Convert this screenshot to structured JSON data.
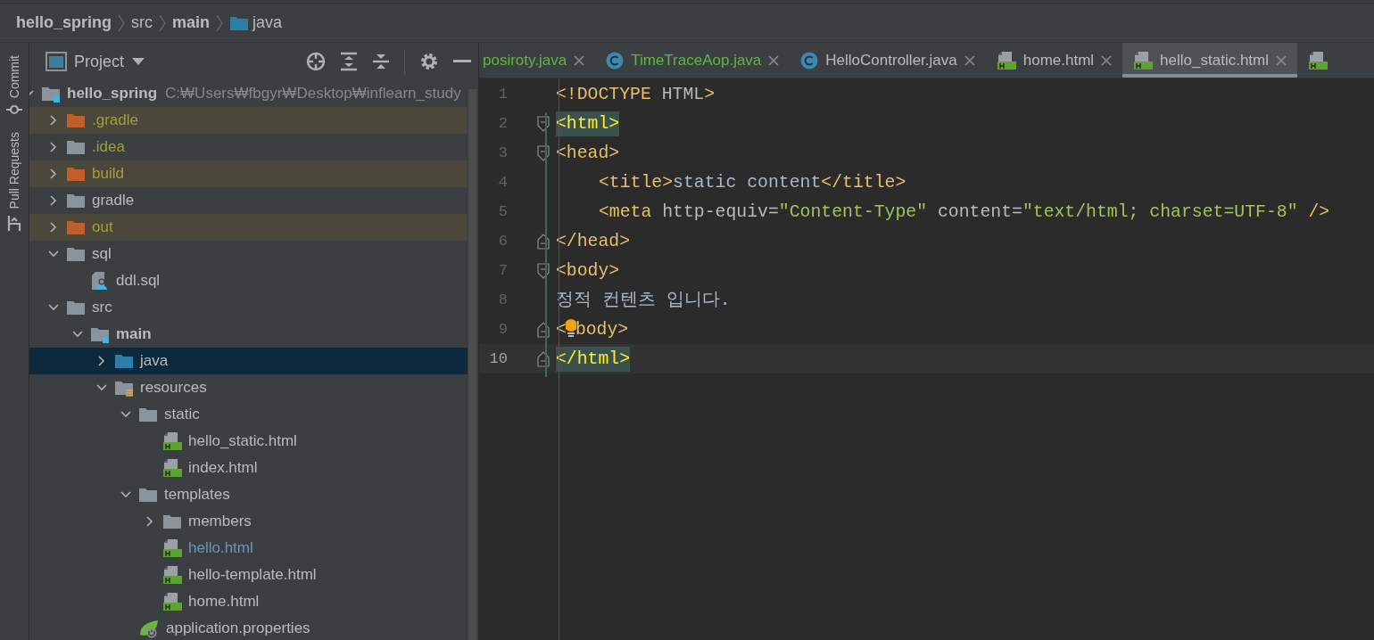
{
  "breadcrumb": [
    {
      "label": "hello_spring",
      "bold": true,
      "folder": false
    },
    {
      "label": "src",
      "bold": false,
      "folder": false
    },
    {
      "label": "main",
      "bold": true,
      "folder": false
    },
    {
      "label": "java",
      "bold": false,
      "folder": true
    }
  ],
  "side_tabs": [
    "Commit",
    "Pull Requests"
  ],
  "project_panel": {
    "view": "Project",
    "root": {
      "name": "hello_spring",
      "path": "C:₩Users₩fbgyr₩Desktop₩inflearn_study",
      "expanded": true
    },
    "tree": [
      {
        "name": ".gradle",
        "kind": "folder",
        "excluded": true,
        "ignored": true,
        "modified": false,
        "expanded": false,
        "selected": false
      },
      {
        "name": ".idea",
        "kind": "folder",
        "excluded": false,
        "ignored": true,
        "modified": false,
        "expanded": false,
        "selected": false
      },
      {
        "name": "build",
        "kind": "folder",
        "excluded": true,
        "ignored": true,
        "modified": false,
        "expanded": false,
        "selected": false
      },
      {
        "name": "gradle",
        "kind": "folder",
        "excluded": false,
        "ignored": false,
        "modified": false,
        "expanded": false,
        "selected": false
      },
      {
        "name": "out",
        "kind": "folder",
        "excluded": true,
        "ignored": true,
        "modified": false,
        "expanded": false,
        "selected": false
      },
      {
        "name": "sql",
        "kind": "folder",
        "excluded": false,
        "ignored": false,
        "modified": false,
        "expanded": true,
        "selected": false,
        "children": [
          {
            "name": "ddl.sql",
            "kind": "sql",
            "excluded": false,
            "ignored": false,
            "modified": false,
            "selected": false
          }
        ]
      },
      {
        "name": "src",
        "kind": "folder",
        "excluded": false,
        "ignored": false,
        "modified": false,
        "expanded": true,
        "selected": false,
        "children": [
          {
            "name": "main",
            "kind": "module",
            "bold": true,
            "excluded": false,
            "ignored": false,
            "modified": false,
            "expanded": true,
            "selected": false,
            "children": [
              {
                "name": "java",
                "kind": "source",
                "excluded": false,
                "ignored": false,
                "modified": false,
                "expanded": false,
                "selected": true
              },
              {
                "name": "resources",
                "kind": "resources",
                "excluded": false,
                "ignored": false,
                "modified": false,
                "expanded": true,
                "selected": false,
                "children": [
                  {
                    "name": "static",
                    "kind": "folder",
                    "excluded": false,
                    "ignored": false,
                    "modified": false,
                    "expanded": true,
                    "selected": false,
                    "children": [
                      {
                        "name": "hello_static.html",
                        "kind": "html",
                        "excluded": false,
                        "ignored": false,
                        "modified": false,
                        "selected": false
                      },
                      {
                        "name": "index.html",
                        "kind": "html",
                        "excluded": false,
                        "ignored": false,
                        "modified": false,
                        "selected": false
                      }
                    ]
                  },
                  {
                    "name": "templates",
                    "kind": "folder",
                    "excluded": false,
                    "ignored": false,
                    "modified": false,
                    "expanded": true,
                    "selected": false,
                    "children": [
                      {
                        "name": "members",
                        "kind": "folder",
                        "excluded": false,
                        "ignored": false,
                        "modified": false,
                        "expanded": false,
                        "selected": false
                      },
                      {
                        "name": "hello.html",
                        "kind": "html",
                        "excluded": false,
                        "ignored": false,
                        "modified": true,
                        "selected": false
                      },
                      {
                        "name": "hello-template.html",
                        "kind": "html",
                        "excluded": false,
                        "ignored": false,
                        "modified": false,
                        "selected": false
                      },
                      {
                        "name": "home.html",
                        "kind": "html",
                        "excluded": false,
                        "ignored": false,
                        "modified": false,
                        "selected": false
                      }
                    ]
                  },
                  {
                    "name": "application.properties",
                    "kind": "spring",
                    "excluded": false,
                    "ignored": false,
                    "modified": false,
                    "selected": false
                  }
                ]
              }
            ]
          }
        ]
      }
    ]
  },
  "tabs": [
    {
      "label": "posiroty.java",
      "kind": "partial",
      "added": true,
      "selected": false
    },
    {
      "label": "TimeTraceAop.java",
      "kind": "class",
      "added": true,
      "selected": false
    },
    {
      "label": "HelloController.java",
      "kind": "class",
      "added": false,
      "selected": false
    },
    {
      "label": "home.html",
      "kind": "html",
      "added": false,
      "selected": false
    },
    {
      "label": "hello_static.html",
      "kind": "html",
      "added": false,
      "selected": true
    },
    {
      "kind": "html",
      "selected": false
    }
  ],
  "editor": {
    "lines": [
      {
        "number": "1",
        "current": false,
        "kind": "plain",
        "indented": false,
        "tokens": [
          {
            "kind": "tag",
            "text": "<!DOCTYPE"
          },
          {
            "kind": "attr",
            "text": "HTML"
          },
          {
            "kind": "tag",
            "text": ">"
          }
        ]
      },
      {
        "number": "2",
        "current": false,
        "kind": "fold_start",
        "indented": false,
        "tokens": [
          {
            "kind": "match",
            "text": "<html>"
          }
        ]
      },
      {
        "number": "3",
        "current": false,
        "kind": "fold_start",
        "indented": false,
        "tokens": [
          {
            "kind": "tag",
            "text": "<head>"
          }
        ]
      },
      {
        "number": "4",
        "current": false,
        "kind": "plain",
        "indented": true,
        "tokens": [
          {
            "kind": "tag",
            "text": "<title>"
          },
          {
            "kind": "plain",
            "text": "static content"
          },
          {
            "kind": "tag",
            "text": "</title>"
          }
        ]
      },
      {
        "number": "5",
        "current": false,
        "kind": "plain",
        "indented": true,
        "tokens": [
          {
            "kind": "tag",
            "text": "<meta"
          },
          {
            "kind": "attr",
            "text": "http-equiv="
          },
          {
            "kind": "string",
            "text": "\"Content-Type\""
          },
          {
            "kind": "attr",
            "text": "content="
          },
          {
            "kind": "string",
            "text": "\"text/html; charset=UTF-8\""
          },
          {
            "kind": "tag",
            "text": "/>"
          }
        ]
      },
      {
        "number": "6",
        "current": false,
        "kind": "fold_end",
        "indented": false,
        "tokens": [
          {
            "kind": "tag",
            "text": "</head>"
          }
        ]
      },
      {
        "number": "7",
        "current": false,
        "kind": "fold_start",
        "indented": false,
        "tokens": [
          {
            "kind": "tag",
            "text": "<body>"
          }
        ]
      },
      {
        "number": "8",
        "current": false,
        "kind": "plain",
        "indented": false,
        "tokens": [
          {
            "kind": "plain",
            "text": "정적 컨텐츠 입니다."
          }
        ]
      },
      {
        "number": "9",
        "current": false,
        "kind": "fold_end",
        "indented": false,
        "tokens": [
          {
            "kind": "tag",
            "text": "<"
          },
          {
            "kind": "bulb"
          },
          {
            "kind": "tag",
            "text": "body>"
          }
        ]
      },
      {
        "number": "10",
        "current": true,
        "kind": "fold_end",
        "indented": false,
        "tokens": [
          {
            "kind": "match",
            "text": "</html>"
          }
        ]
      }
    ]
  }
}
